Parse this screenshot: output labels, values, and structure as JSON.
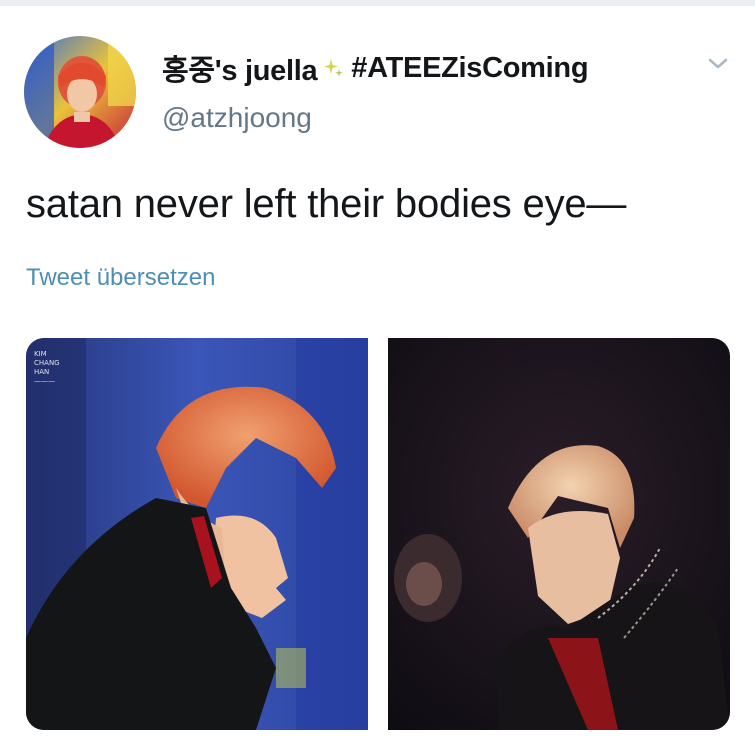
{
  "tweet": {
    "display_name": "홍중's juella",
    "name_emoji": "sparkle-icon",
    "hashtag": "#ATEEZisComing",
    "handle": "@atzhjoong",
    "text": "satan never left their bodies eye—",
    "translate_link": "Tweet übersetzen",
    "menu_icon": "chevron-down-icon"
  },
  "media": {
    "watermark": "KIM\nCHANG\nHAN\n———",
    "images": [
      {
        "name": "photo-left",
        "icon": "photo"
      },
      {
        "name": "photo-right",
        "icon": "photo"
      }
    ]
  },
  "colors": {
    "text_primary": "#14171a",
    "text_secondary": "#657786",
    "link": "#4d8fb4"
  }
}
